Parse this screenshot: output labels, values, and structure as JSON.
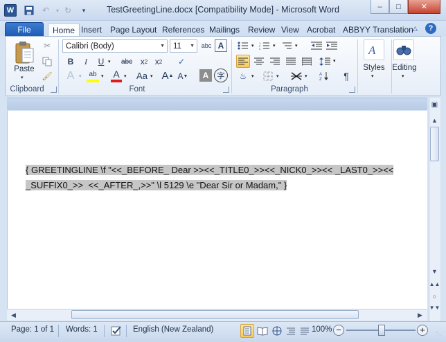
{
  "window": {
    "title": "TestGreetingLine.docx [Compatibility Mode]  -  Microsoft Word",
    "app_icon_letter": "W",
    "minimize": "–",
    "maximize": "□",
    "close": "✕"
  },
  "tabs": {
    "file": "File",
    "items": [
      "Home",
      "Insert",
      "Page Layout",
      "References",
      "Mailings",
      "Review",
      "View",
      "Acrobat",
      "ABBYY Translation"
    ],
    "active": "Home"
  },
  "ribbon": {
    "clipboard": {
      "label": "Clipboard",
      "paste": "Paste"
    },
    "font": {
      "label": "Font",
      "font_name": "Calibri (Body)",
      "font_size": "11"
    },
    "paragraph": {
      "label": "Paragraph"
    },
    "styles": {
      "label": "Styles"
    },
    "editing": {
      "label": "Editing"
    }
  },
  "document": {
    "line1": "{ GREETINGLINE \\f \"<<_BEFORE_ Dear >><<_TITLE0_>><<_NICK0_>><< _LAST0_>><<",
    "line2": "_SUFFIX0_>>  <<_AFTER_,>>\" \\l 5129 \\e \"Dear Sir or Madam,\" }"
  },
  "statusbar": {
    "page": "Page: 1 of 1",
    "words": "Words: 1",
    "language": "English (New Zealand)",
    "zoom": "100%",
    "zoom_out": "−",
    "zoom_in": "+"
  },
  "colors": {
    "title_bg": "#c9d9ee",
    "file_tab": "#1f5bb5",
    "field_highlight": "#c6c6c6",
    "close_button": "#c6442f"
  }
}
